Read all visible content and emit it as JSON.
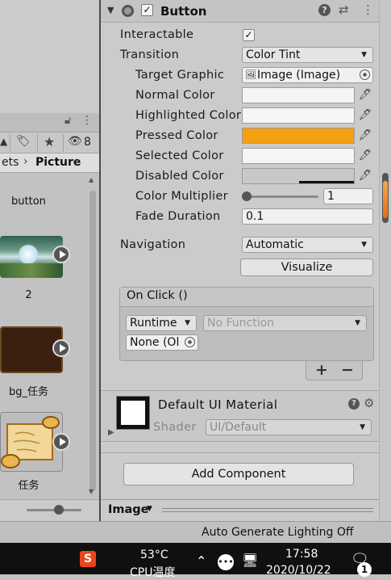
{
  "project": {
    "breadcrumb_prefix": "ets",
    "breadcrumb_current": "Picture",
    "filter_count": "8",
    "assets": [
      {
        "label": "button"
      },
      {
        "label": "2"
      },
      {
        "label": "bg_任务"
      },
      {
        "label": "任务"
      }
    ]
  },
  "component": {
    "title": "Button",
    "enabled": true,
    "interactable_label": "Interactable",
    "interactable_checked": "✓",
    "transition_label": "Transition",
    "transition_value": "Color Tint",
    "target_graphic_label": "Target Graphic",
    "target_graphic_value": "Image (Image)",
    "normal_color_label": "Normal Color",
    "highlighted_color_label": "Highlighted Color",
    "pressed_color_label": "Pressed Color",
    "selected_color_label": "Selected Color",
    "disabled_color_label": "Disabled Color",
    "color_multiplier_label": "Color Multiplier",
    "color_multiplier_value": "1",
    "fade_duration_label": "Fade Duration",
    "fade_duration_value": "0.1",
    "navigation_label": "Navigation",
    "navigation_value": "Automatic",
    "visualize_label": "Visualize",
    "onclick_title": "On Click ()",
    "runtime_value": "Runtime",
    "function_value": "No Function",
    "object_value": "None (Ol",
    "add_label": "+",
    "remove_label": "−",
    "colors": {
      "normal": "#f5f5f5",
      "highlighted": "#f5f5f5",
      "pressed": "#f4a012",
      "selected": "#f5f5f5",
      "disabled": "#c8c8c8"
    }
  },
  "material": {
    "name": "Default UI Material",
    "shader_label": "Shader",
    "shader_value": "UI/Default"
  },
  "add_component_label": "Add Component",
  "preview": {
    "label": "Image"
  },
  "status": {
    "text": "Auto Generate Lighting Off"
  },
  "taskbar": {
    "temp": "53°C",
    "temp_label": "CPU温度",
    "time": "17:58",
    "date": "2020/10/22",
    "notification_count": "1"
  }
}
